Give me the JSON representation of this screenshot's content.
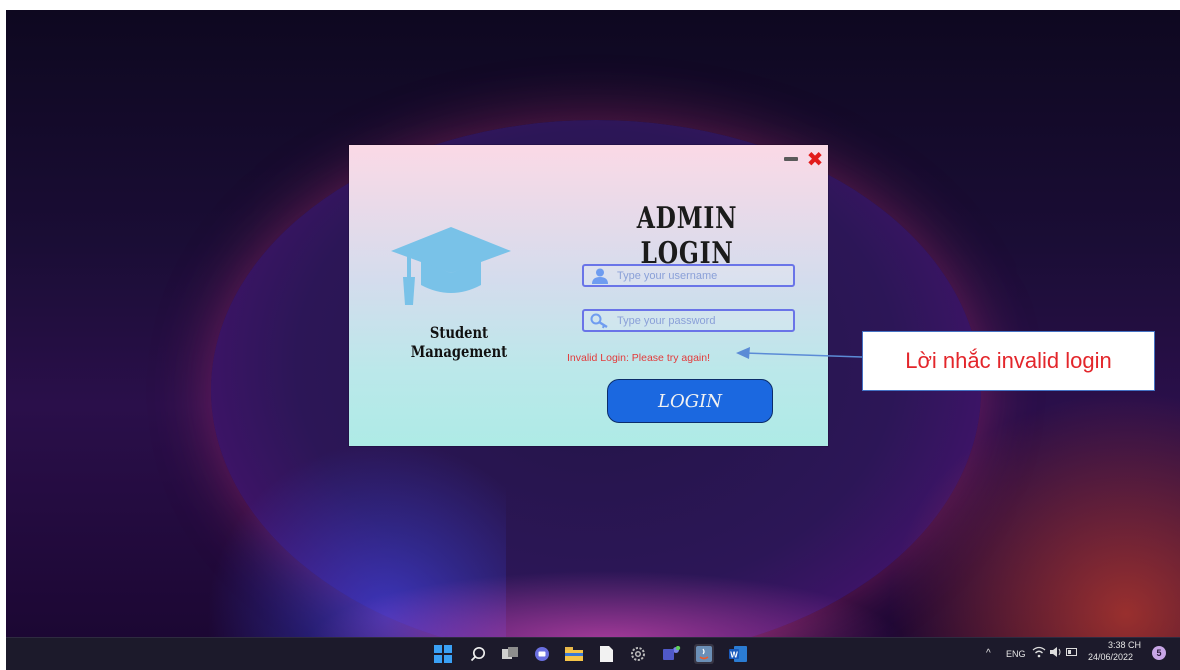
{
  "window": {
    "app_name": "Student Management",
    "title": "ADMIN LOGIN",
    "username_placeholder": "Type your username",
    "password_placeholder": "Type your password",
    "error_message": "Invalid Login: Please try again!",
    "login_button_label": "LOGIN",
    "controls": {
      "minimize_icon": "minimize-icon",
      "close_icon": "close-icon",
      "close_color": "#e21b1b"
    },
    "accent_color": "#1b68e0"
  },
  "annotation": {
    "text": "Lời nhắc invalid login",
    "text_color": "#e3262b"
  },
  "taskbar": {
    "icons": [
      "windows-start-icon",
      "search-icon",
      "task-view-icon",
      "chat-icon",
      "file-explorer-icon",
      "notepad-icon",
      "settings-icon",
      "teams-icon",
      "java-icon",
      "word-icon"
    ],
    "tray": {
      "chevron": "^",
      "language": "ENG",
      "time": "3:38 CH",
      "date": "24/06/2022",
      "notification_count": "5"
    }
  }
}
